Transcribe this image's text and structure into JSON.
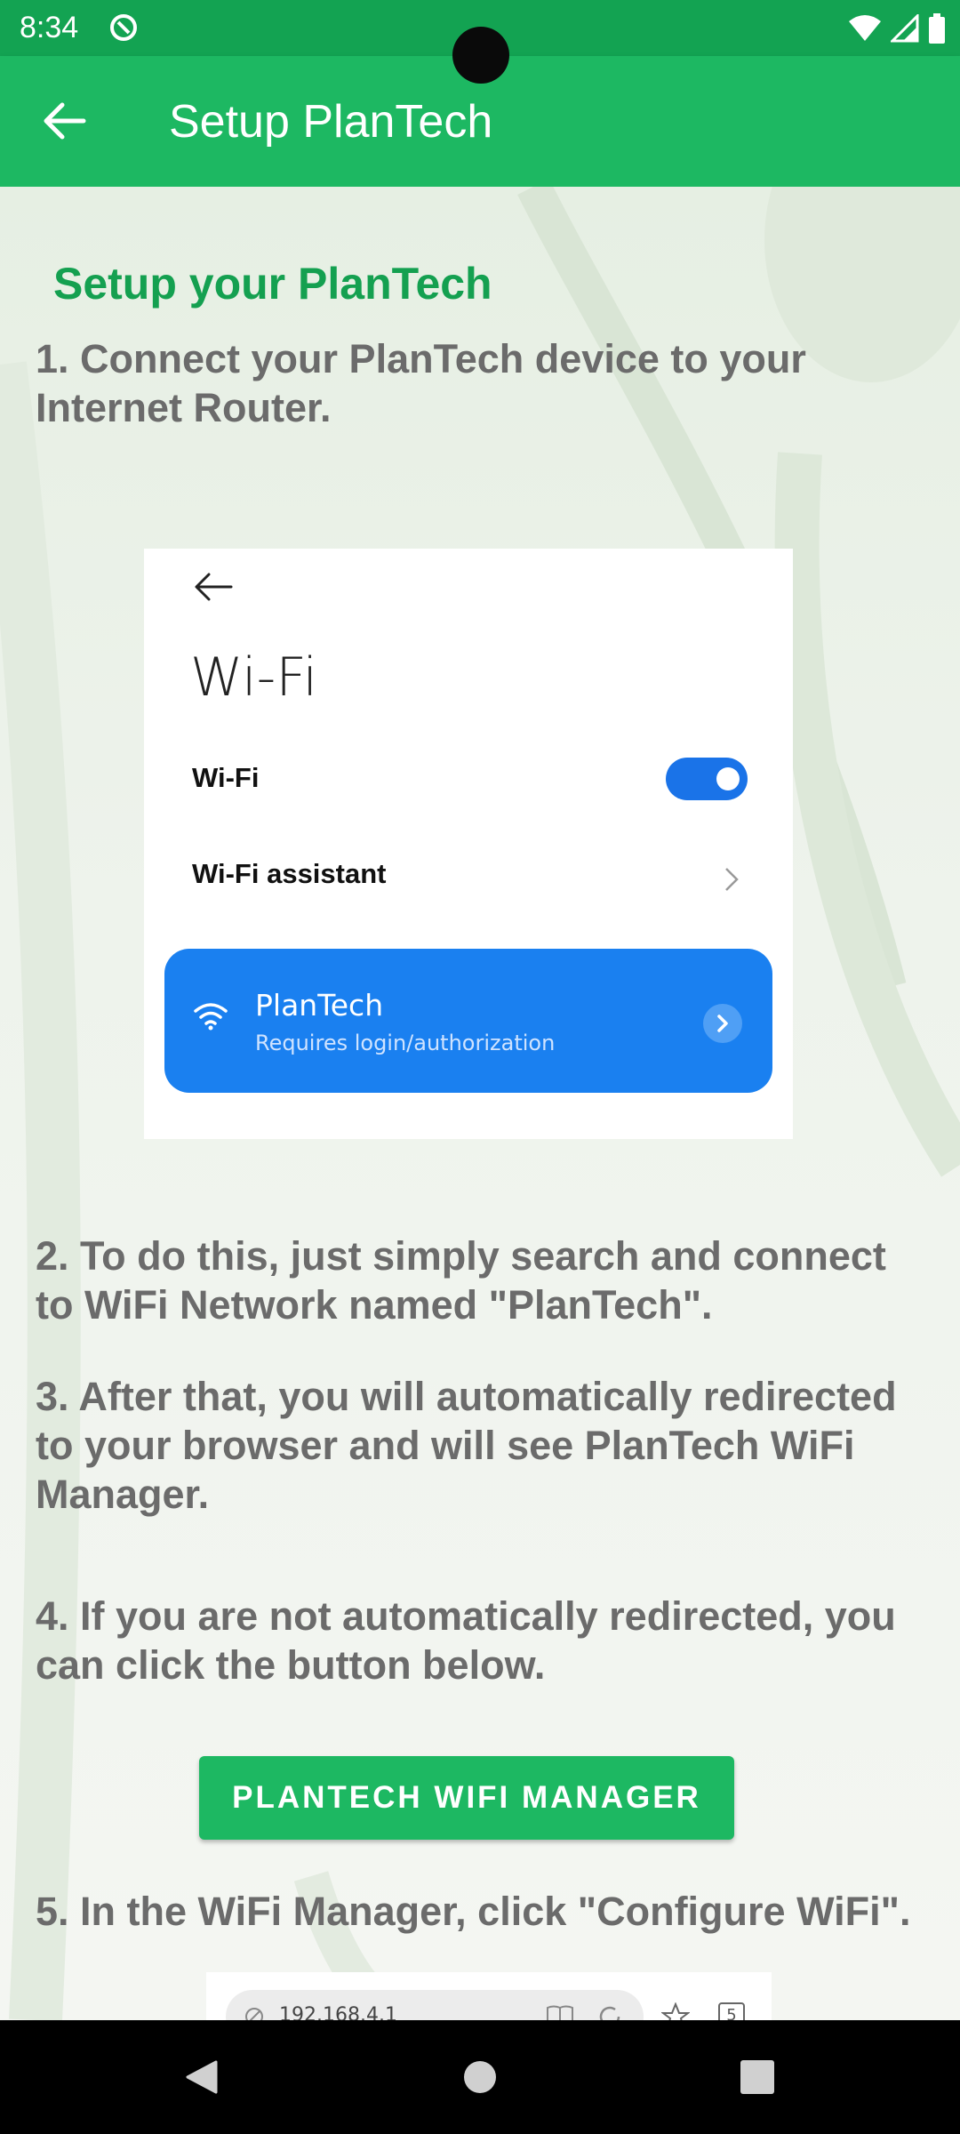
{
  "status_bar": {
    "time": "8:34"
  },
  "app_bar": {
    "title": "Setup PlanTech",
    "back_icon": "arrow-left-icon"
  },
  "content": {
    "heading": "Setup your PlanTech",
    "steps": [
      "1. Connect your PlanTech device to your Internet Router.",
      "2. To do this, just simply search and connect to WiFi Network named \"PlanTech\".",
      "3. After that, you will automatically redirected to your browser and will see PlanTech WiFi Manager.",
      "4. If you are not automatically redirected, you can click the button below.",
      "5. In the WiFi Manager, click \"Configure WiFi\"."
    ],
    "wifi_illustration": {
      "title": "Wi-Fi",
      "wifi_row": "Wi-Fi",
      "wifi_enabled": true,
      "assistant_row": "Wi-Fi assistant",
      "network_name": "PlanTech",
      "network_status": "Requires login/authorization"
    },
    "manager_button": "PLANTECH WIFI MANAGER",
    "browser_illustration": {
      "url": "192.168.4.1",
      "tab_count": "5"
    }
  },
  "colors": {
    "primary": "#1db862",
    "status_bar": "#13a352",
    "heading": "#14a050",
    "body_text": "#6b6b6b",
    "network_card": "#1a80f0"
  }
}
